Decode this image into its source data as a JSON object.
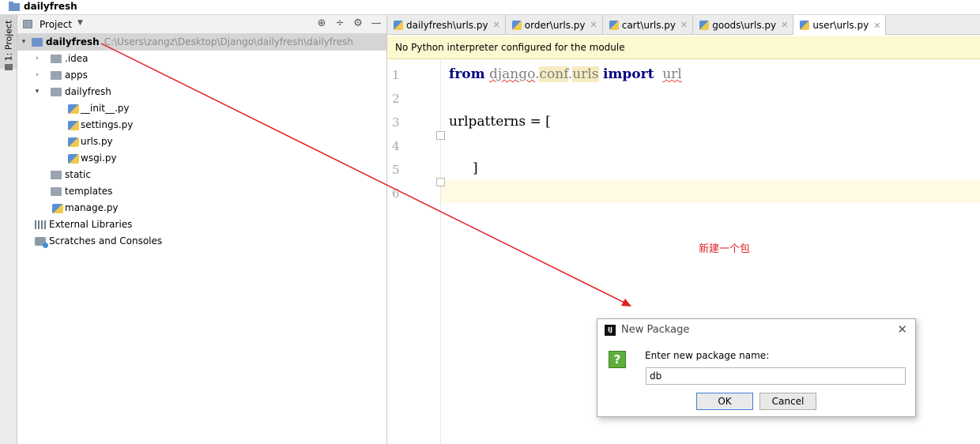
{
  "window": {
    "title": "dailyfresh"
  },
  "toolstrip": {
    "project_tab": "1: Project"
  },
  "project_panel": {
    "header_label": "Project",
    "tree": [
      {
        "label": "dailyfresh",
        "path": "C:\\Users\\zangz\\Desktop\\Django\\dailyfresh\\dailyfresh",
        "type": "root",
        "expanded": true
      },
      {
        "label": ".idea",
        "type": "folder"
      },
      {
        "label": "apps",
        "type": "folder"
      },
      {
        "label": "dailyfresh",
        "type": "folder",
        "expanded": true
      },
      {
        "label": "__init__.py",
        "type": "py"
      },
      {
        "label": "settings.py",
        "type": "py"
      },
      {
        "label": "urls.py",
        "type": "py"
      },
      {
        "label": "wsgi.py",
        "type": "py"
      },
      {
        "label": "static",
        "type": "folder"
      },
      {
        "label": "templates",
        "type": "folder"
      },
      {
        "label": "manage.py",
        "type": "py"
      },
      {
        "label": "External Libraries",
        "type": "libs"
      },
      {
        "label": "Scratches and Consoles",
        "type": "scratch"
      }
    ]
  },
  "tabs": [
    {
      "label": "dailyfresh\\urls.py",
      "active": false
    },
    {
      "label": "order\\urls.py",
      "active": false
    },
    {
      "label": "cart\\urls.py",
      "active": false
    },
    {
      "label": "goods\\urls.py",
      "active": false
    },
    {
      "label": "user\\urls.py",
      "active": true
    }
  ],
  "banner": {
    "text": "No Python interpreter configured for the module"
  },
  "editor": {
    "line_numbers": [
      "1",
      "2",
      "3",
      "4",
      "5",
      "6"
    ],
    "code": {
      "l1_from": "from",
      "l1_django": "django",
      "l1_dot1": ".",
      "l1_conf": "conf",
      "l1_dot2": ".",
      "l1_urls": "urls",
      "l1_import": "import",
      "l1_url": "url",
      "l3": "urlpatterns = [",
      "l5": "]"
    }
  },
  "annotation": {
    "text": "新建一个包",
    "color": "#e02020"
  },
  "dialog": {
    "title": "New Package",
    "prompt": "Enter new package name:",
    "input_value": "db",
    "ok_label": "OK",
    "cancel_label": "Cancel"
  },
  "colors": {
    "banner_bg": "#fcf8cf",
    "selection_bg": "#d5d5d5",
    "arrow": "#e02020",
    "keyword": "#000080"
  }
}
